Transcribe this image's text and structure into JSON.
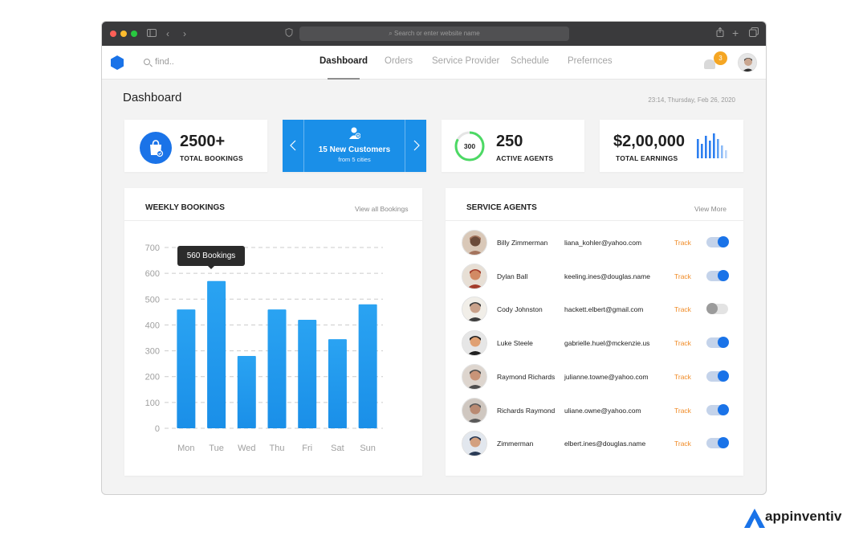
{
  "browser": {
    "url_placeholder": "Search or enter website name"
  },
  "nav": {
    "search_placeholder": "find..",
    "tabs": [
      "Dashboard",
      "Orders",
      "Service Provider",
      "Schedule",
      "Prefernces"
    ],
    "active_tab": "Dashboard",
    "notification_count": "3"
  },
  "page": {
    "title": "Dashboard",
    "datetime": "23:14, Thursday, Feb 26, 2020"
  },
  "stats": {
    "bookings_value": "2500+",
    "bookings_label": "TOTAL BOOKINGS",
    "customers_title": "15 New Customers",
    "customers_sub": "from 5 cities",
    "agents_ring": "300",
    "agents_value": "250",
    "agents_label": "ACTIVE AGENTS",
    "earnings_value": "$2,00,000",
    "earnings_label": "TOTAL EARNINGS"
  },
  "weekly": {
    "title": "WEEKLY BOOKINGS",
    "link": "View all Bookings",
    "tooltip": "560 Bookings"
  },
  "chart_data": {
    "type": "bar",
    "categories": [
      "Mon",
      "Tue",
      "Wed",
      "Thu",
      "Fri",
      "Sat",
      "Sun"
    ],
    "values": [
      460,
      570,
      280,
      460,
      420,
      345,
      480
    ],
    "ylim": [
      0,
      700
    ],
    "yticks": [
      0,
      100,
      200,
      300,
      400,
      500,
      600,
      700
    ],
    "grid": true,
    "color": "#1a8fe8"
  },
  "agents": {
    "title": "SERVICE AGENTS",
    "link": "View More",
    "track_label": "Track",
    "rows": [
      {
        "name": "Billy Zimmerman",
        "email": "liana_kohler@yahoo.com",
        "on": true
      },
      {
        "name": "Dylan Ball",
        "email": "keeling.ines@douglas.name",
        "on": true
      },
      {
        "name": "Cody Johnston",
        "email": "hackett.elbert@gmail.com",
        "on": false
      },
      {
        "name": "Luke Steele",
        "email": "gabrielle.huel@mckenzie.us",
        "on": true
      },
      {
        "name": "Raymond Richards",
        "email": "julianne.towne@yahoo.com",
        "on": true
      },
      {
        "name": "Richards Raymond",
        "email": "uliane.owne@yahoo.com",
        "on": true
      },
      {
        "name": "Zimmerman",
        "email": "elbert.ines@douglas.name",
        "on": true
      }
    ]
  },
  "brand": {
    "name": "appinventiv",
    "accent": "#1a73e8"
  }
}
